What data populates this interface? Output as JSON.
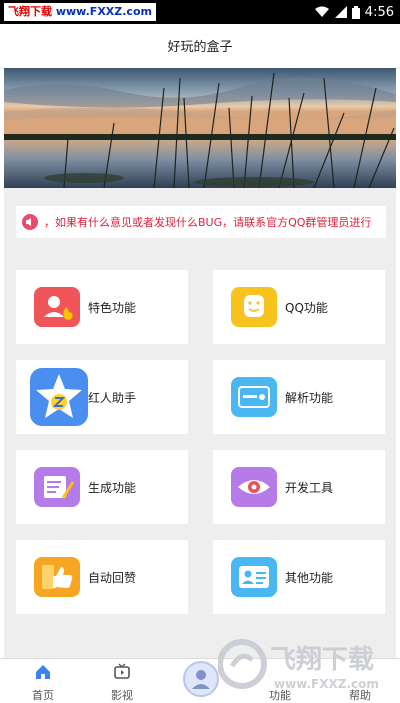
{
  "status_bar": {
    "watermark_left": "飞翔下载",
    "watermark_right": "www.FXXZ.com",
    "time": "4:56"
  },
  "header": {
    "title": "好玩的盒子"
  },
  "notice": {
    "text": "，如果有什么意见或者发现什么BUG，请联系官方QQ群管理员进行"
  },
  "features": [
    {
      "label": "特色功能",
      "icon": "user-fire-icon",
      "color": "#f0555a"
    },
    {
      "label": "QQ功能",
      "icon": "qq-face-icon",
      "color": "#f8c21f"
    },
    {
      "label": "红人助手",
      "icon": "star-z-icon",
      "color": "#4a8ff0"
    },
    {
      "label": "解析功能",
      "icon": "card-icon",
      "color": "#4ab6f2"
    },
    {
      "label": "生成功能",
      "icon": "note-pen-icon",
      "color": "#b57be8"
    },
    {
      "label": "开发工具",
      "icon": "eye-icon",
      "color": "#b57be8"
    },
    {
      "label": "自动回赞",
      "icon": "thumb-up-icon",
      "color": "#f6a623"
    },
    {
      "label": "其他功能",
      "icon": "id-card-icon",
      "color": "#4ab6f2"
    }
  ],
  "tabs": [
    {
      "label": "首页",
      "icon": "home-icon"
    },
    {
      "label": "影视",
      "icon": "tv-icon"
    },
    {
      "label": "",
      "icon": "avatar-icon"
    },
    {
      "label": "功能",
      "icon": "apps-icon"
    },
    {
      "label": "帮助",
      "icon": "help-icon"
    }
  ],
  "watermark": {
    "text": "飞翔下载",
    "url": "www.FXXZ.com"
  }
}
